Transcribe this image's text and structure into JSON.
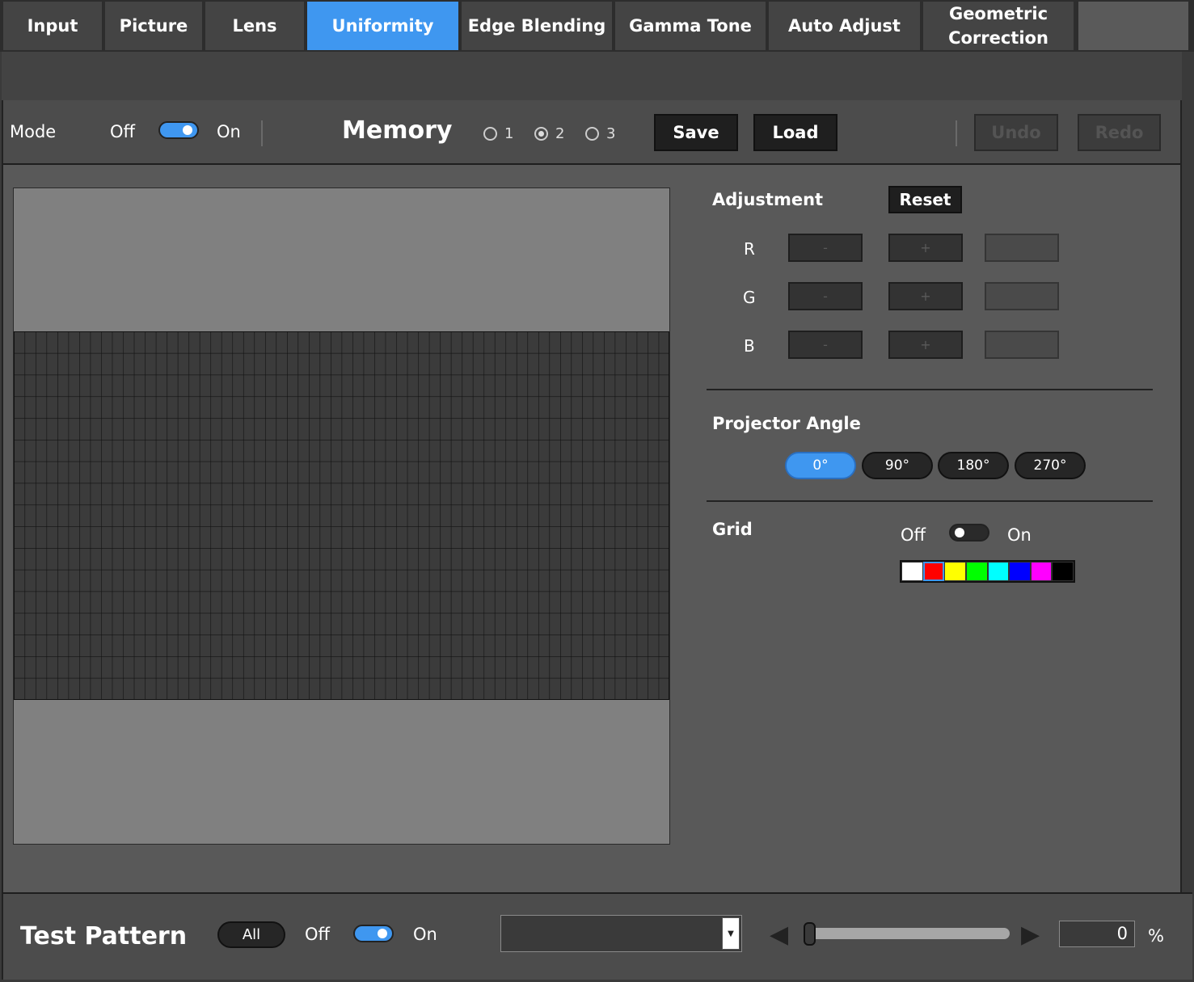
{
  "tabs": [
    {
      "label": "Input"
    },
    {
      "label": "Picture"
    },
    {
      "label": "Lens"
    },
    {
      "label": "Uniformity",
      "active": true
    },
    {
      "label": "Edge Blending"
    },
    {
      "label": "Gamma Tone"
    },
    {
      "label": "Auto Adjust"
    },
    {
      "label": "Geometric\nCorrection"
    }
  ],
  "mode": {
    "label": "Mode",
    "off": "Off",
    "on": "On",
    "enabled": true
  },
  "memory": {
    "label": "Memory",
    "options": [
      "1",
      "2",
      "3"
    ],
    "selected": "2",
    "save_label": "Save",
    "load_label": "Load",
    "undo_label": "Undo",
    "redo_label": "Redo"
  },
  "adjustment": {
    "title": "Adjustment",
    "reset_label": "Reset",
    "minus_label": "-",
    "plus_label": "+",
    "channels": [
      "R",
      "G",
      "B"
    ]
  },
  "projector_angle": {
    "title": "Projector Angle",
    "options": [
      "0°",
      "90°",
      "180°",
      "270°"
    ],
    "selected": "0°"
  },
  "grid": {
    "title": "Grid",
    "off": "Off",
    "on": "On",
    "enabled": false,
    "colors": [
      "#ffffff",
      "#ff0000",
      "#ffff00",
      "#00ff00",
      "#00ffff",
      "#0000ff",
      "#ff00ff",
      "#000000"
    ],
    "selected_color": "#ff0000"
  },
  "test_pattern": {
    "title": "Test Pattern",
    "all_label": "All",
    "off": "Off",
    "on": "On",
    "enabled": true,
    "dropdown_value": "",
    "value": "0",
    "unit": "%",
    "level": 0
  }
}
